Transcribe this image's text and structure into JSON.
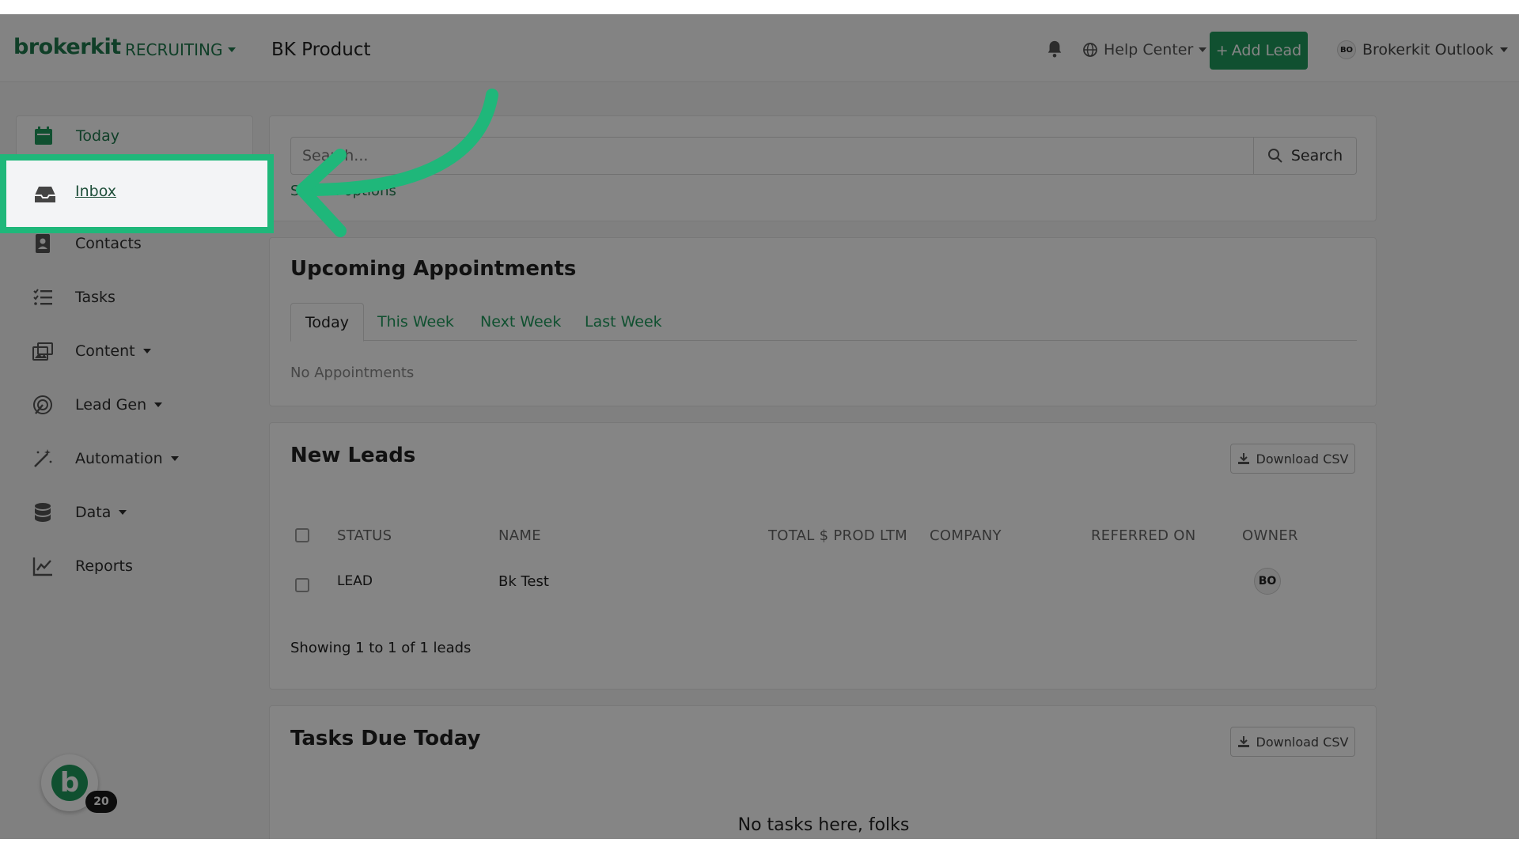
{
  "header": {
    "logo": "brokerkit",
    "module": "RECRUITING",
    "org_name": "BK Product",
    "help_center": "Help Center",
    "add_lead": "Add Lead",
    "user_initials": "BO",
    "user_name": "Brokerkit Outlook"
  },
  "sidebar": {
    "items": [
      {
        "label": "Today",
        "icon": "calendar-icon"
      },
      {
        "label": "Inbox",
        "icon": "inbox-icon"
      },
      {
        "label": "Contacts",
        "icon": "contact-book-icon"
      },
      {
        "label": "Tasks",
        "icon": "task-list-icon"
      },
      {
        "label": "Content",
        "icon": "content-icon"
      },
      {
        "label": "Lead Gen",
        "icon": "lead-gen-icon"
      },
      {
        "label": "Automation",
        "icon": "magic-wand-icon"
      },
      {
        "label": "Data",
        "icon": "database-icon"
      },
      {
        "label": "Reports",
        "icon": "chart-icon"
      }
    ],
    "badge_count": "20"
  },
  "search": {
    "placeholder": "Search...",
    "button": "Search",
    "options_link": "Search options"
  },
  "appointments": {
    "title": "Upcoming Appointments",
    "tabs": [
      "Today",
      "This Week",
      "Next Week",
      "Last Week"
    ],
    "active_tab": "Today",
    "empty": "No Appointments"
  },
  "leads": {
    "title": "New Leads",
    "download": "Download CSV",
    "columns": [
      "STATUS",
      "NAME",
      "TOTAL $ PROD LTM",
      "COMPANY",
      "REFERRED ON",
      "OWNER"
    ],
    "rows": [
      {
        "status": "LEAD",
        "name": "Bk Test",
        "total": "",
        "company": "",
        "referred_on": "",
        "owner": "BO"
      }
    ],
    "footer": "Showing 1 to 1 of 1 leads"
  },
  "tasks": {
    "title": "Tasks Due Today",
    "download": "Download CSV",
    "empty": "No tasks here, folks"
  },
  "colors": {
    "brand": "#1f7a4e",
    "accent": "#1f9a5c",
    "highlight": "#1fb77a"
  }
}
